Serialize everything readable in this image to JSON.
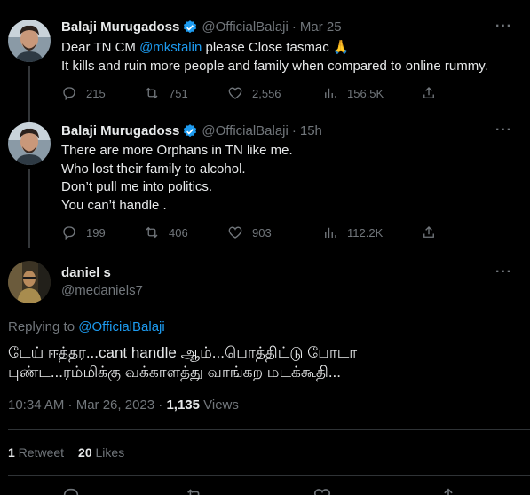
{
  "tweets": [
    {
      "name": "Balaji Murugadoss",
      "handle": "@OfficialBalaji",
      "separator": "·",
      "time": "Mar 25",
      "line1_prefix": "Dear TN CM ",
      "line1_mention": "@mkstalin",
      "line1_suffix": " please Close tasmac 🙏",
      "line2": "It kills and ruin more people and family when compared to online rummy.",
      "replies": "215",
      "retweets": "751",
      "likes": "2,556",
      "views": "156.5K"
    },
    {
      "name": "Balaji Murugadoss",
      "handle": "@OfficialBalaji",
      "separator": "·",
      "time": "15h",
      "lines": [
        "There are more Orphans in TN like me.",
        "Who lost their family to alcohol.",
        "Don’t pull me into politics.",
        "You can’t handle ."
      ],
      "replies": "199",
      "retweets": "406",
      "likes": "903",
      "views": "112.2K"
    }
  ],
  "main": {
    "name": "daniel s",
    "handle": "@medaniels7",
    "replying_prefix": "Replying to ",
    "replying_to": "@OfficialBalaji",
    "lines": [
      "டேய் ஈத்தர...cant handle ஆம்...பொத்திட்டு போடா",
      "புண்ட...ரம்மிக்கு வக்காளத்து வாங்கற மடக்கூதி..."
    ],
    "timestamp": "10:34 AM · Mar 26, 2023 · ",
    "views_count": "1,135",
    "views_label": " Views",
    "retweet_count": "1",
    "retweet_label": " Retweet",
    "likes_count": "20",
    "likes_label": " Likes"
  },
  "icons": {
    "more": "···",
    "reply": "reply-icon",
    "retweet": "retweet-icon",
    "like": "heart-icon",
    "views": "views-icon",
    "share": "share-icon",
    "verified": "verified-badge-icon"
  },
  "colors": {
    "background": "#000000",
    "text": "#e7e9ea",
    "muted": "#71767b",
    "accent": "#1d9bf0"
  }
}
